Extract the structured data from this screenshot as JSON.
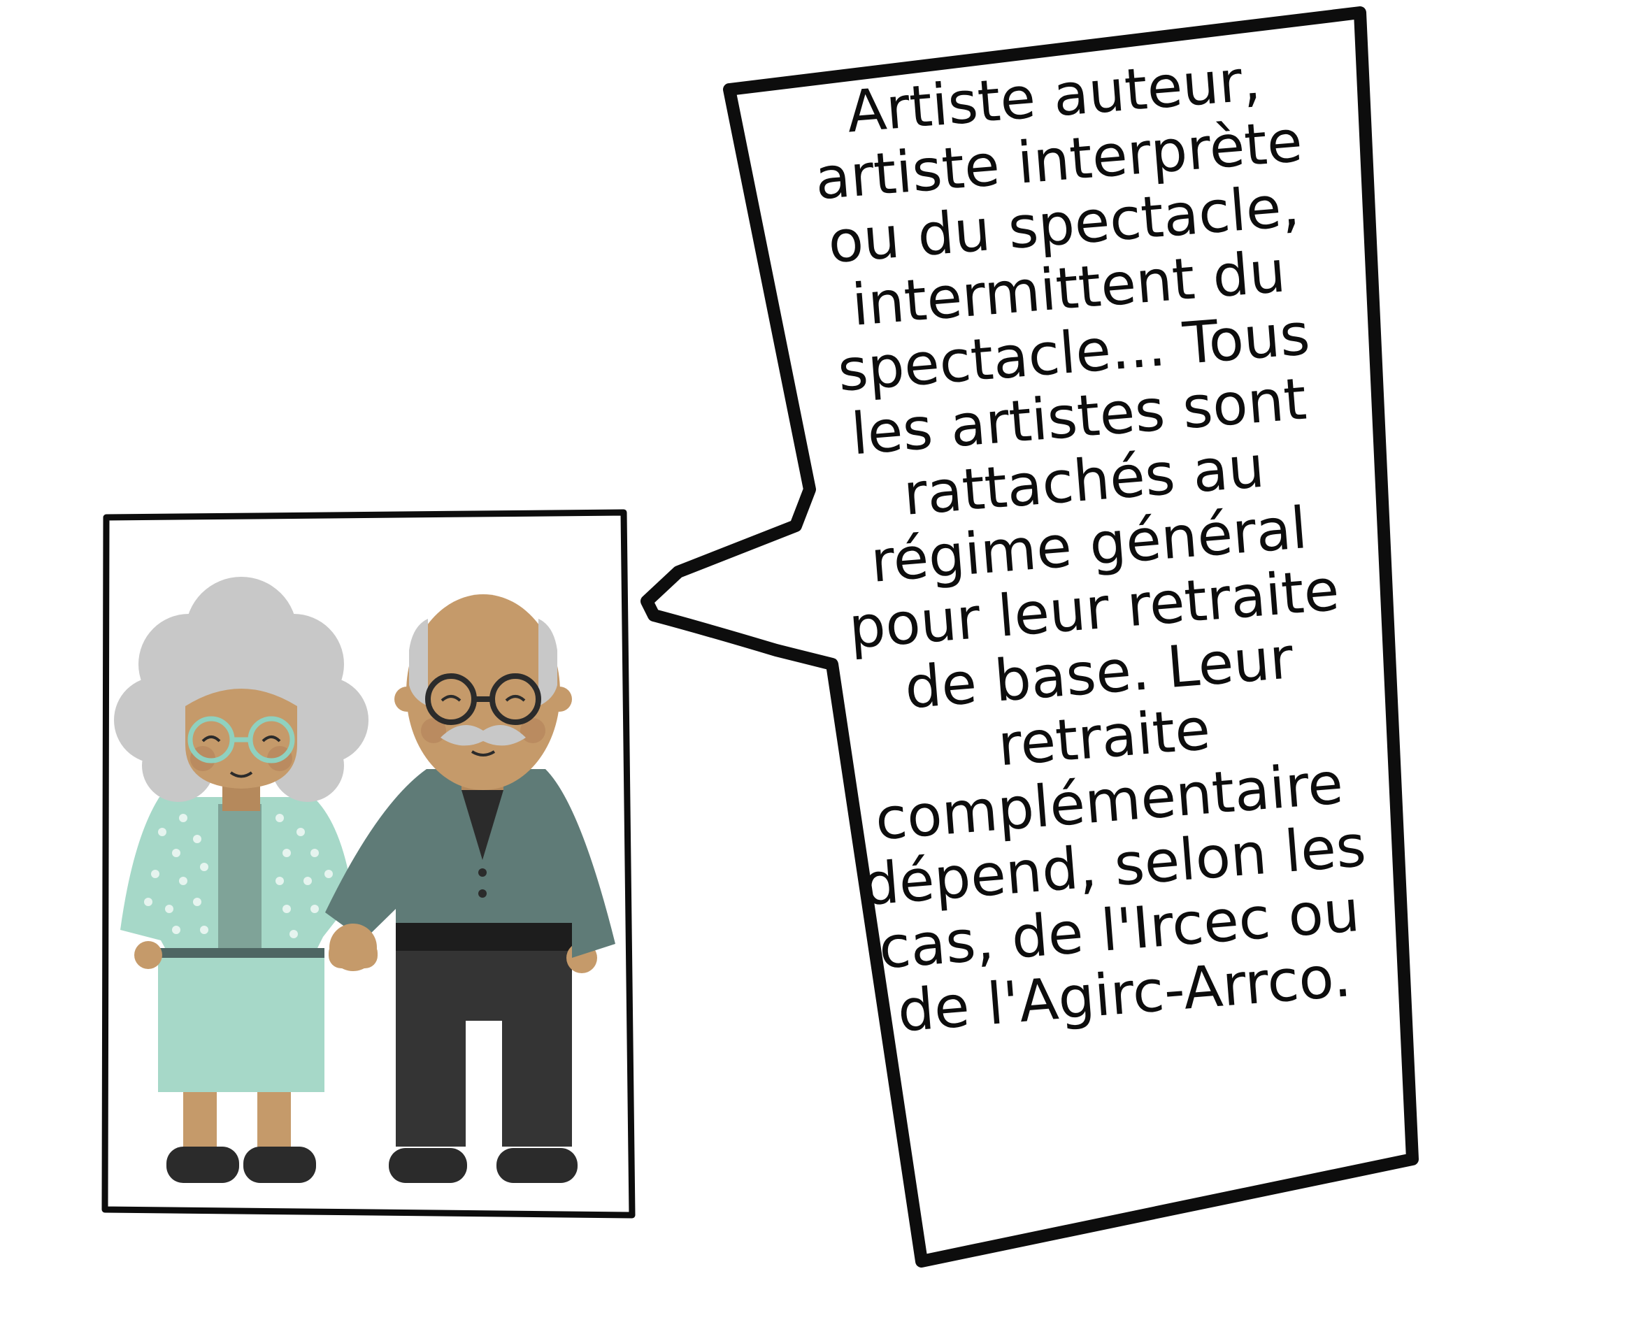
{
  "speech_bubble": {
    "lines": [
      "Artiste auteur,",
      "artiste interprète",
      "ou du spectacle,",
      "intermittent du",
      "spectacle... Tous",
      "les artistes sont",
      "rattachés au",
      "régime général",
      "pour leur retraite",
      "de base. Leur",
      "retraite",
      "complémentaire",
      "dépend, selon les",
      "cas, de l'Ircec ou",
      "de l'Agirc-Arrco."
    ]
  },
  "colors": {
    "outline": "#0d0d0d",
    "background": "#ffffff",
    "skin": "#c59a6a",
    "hair_gray": "#c8c8c8",
    "jacket_mint": "#a6d8c8",
    "jacket_slate": "#5f7b77",
    "trousers": "#343434",
    "shoes": "#2b2b2b"
  },
  "illustration": {
    "characters": [
      "elderly-woman",
      "elderly-man"
    ],
    "icons": [
      "glasses-icon",
      "mustache-icon",
      "polka-dot-pattern"
    ]
  }
}
